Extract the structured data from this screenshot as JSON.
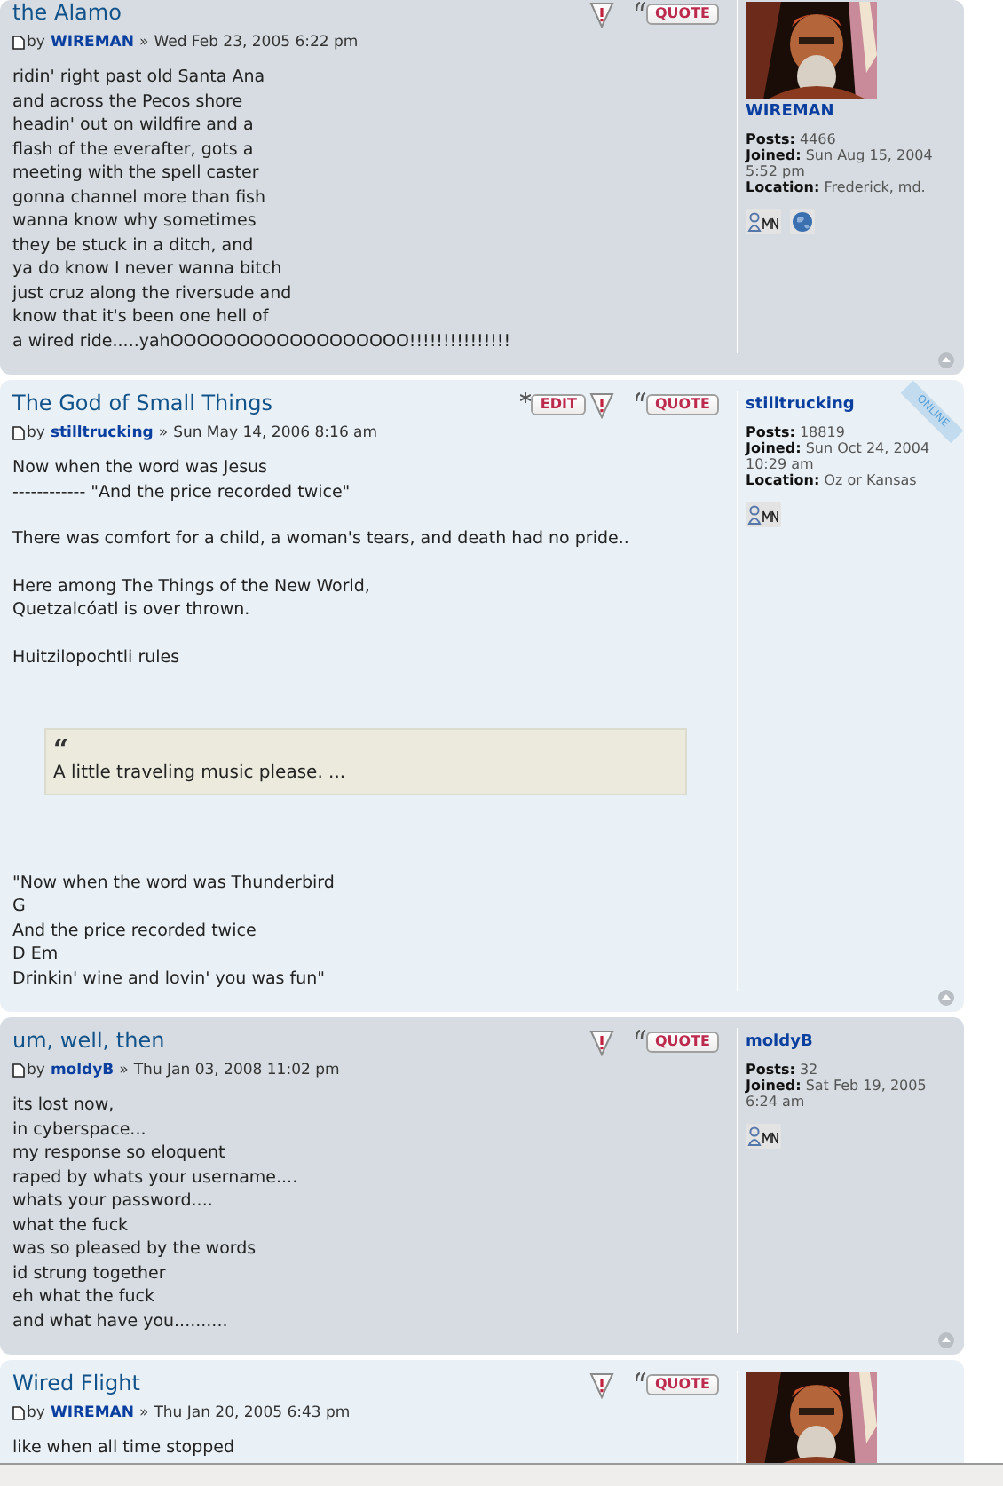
{
  "posts": [
    {
      "title": "the Alamo",
      "by": "by",
      "author": "WIREMAN",
      "sep": "»",
      "date": "Wed Feb 23, 2005 6:22 pm",
      "online": false,
      "buttons": [
        {
          "kind": "report"
        },
        {
          "kind": "quote",
          "label": "QUOTE"
        }
      ],
      "body": [
        {
          "kind": "verse",
          "lines": [
            "ridin' right past old Santa Ana",
            "and across the Pecos shore",
            "headin' out on wildfire and a",
            "flash of the everafter, gots a",
            "meeting with the spell caster",
            "gonna channel more than fish",
            "wanna know why sometimes",
            "they be stuck in a ditch, and",
            "ya do know I never wanna bitch",
            "just cruz along the riversude and",
            "know that it's been one hell of",
            "a wired ride.....yahOOOOOOOOOOOOOOOOOO!!!!!!!!!!!!!!!"
          ]
        }
      ],
      "profile": {
        "avatar": {
          "kind": "picture"
        },
        "name": "WIREMAN",
        "fields": [
          {
            "label": "Posts:",
            "value": "4466"
          },
          {
            "label": "Joined:",
            "value": "Sun Aug 15, 2004 5:52 pm"
          },
          {
            "label": "Location:",
            "value": "Frederick, md."
          }
        ],
        "contacts": [
          {
            "kind": "pm"
          },
          {
            "kind": "website"
          }
        ]
      }
    },
    {
      "title": "The God of Small Things",
      "by": "by",
      "author": "stilltrucking",
      "sep": "»",
      "date": "Sun May 14, 2006 8:16 am",
      "online": true,
      "online_label": "ONLINE",
      "buttons": [
        {
          "kind": "edit",
          "label": "EDIT"
        },
        {
          "kind": "report"
        },
        {
          "kind": "quote",
          "label": "QUOTE"
        }
      ],
      "body": [
        {
          "kind": "verse",
          "lines": [
            "Now when the word was Jesus",
            "------------ \"And the price recorded twice\""
          ]
        },
        {
          "kind": "verse",
          "lines": [
            "There was comfort for a child, a woman's tears, and death had no pride.."
          ]
        },
        {
          "kind": "verse",
          "lines": [
            "Here among The Things of the New World,",
            "Quetzalcóatl is over thrown."
          ]
        },
        {
          "kind": "verse",
          "lines": [
            "Huitzilopochtli rules"
          ]
        },
        {
          "kind": "quote",
          "mark": "“",
          "text": "A little traveling music please. ..."
        },
        {
          "kind": "verse",
          "lines": [
            "\"Now when the word was Thunderbird",
            "G",
            "And the price recorded twice",
            "D Em",
            "Drinkin' wine and lovin' you was fun\""
          ]
        }
      ],
      "profile": {
        "name": "stilltrucking",
        "fields": [
          {
            "label": "Posts:",
            "value": "18819"
          },
          {
            "label": "Joined:",
            "value": "Sun Oct 24, 2004 10:29 am"
          },
          {
            "label": "Location:",
            "value": "Oz or Kansas"
          }
        ],
        "contacts": [
          {
            "kind": "pm"
          }
        ]
      }
    },
    {
      "title": "um, well, then",
      "by": "by",
      "author": "moldyB",
      "sep": "»",
      "date": "Thu Jan 03, 2008 11:02 pm",
      "online": false,
      "buttons": [
        {
          "kind": "report"
        },
        {
          "kind": "quote",
          "label": "QUOTE"
        }
      ],
      "body": [
        {
          "kind": "verse",
          "lines": [
            "its lost now,",
            "in cyberspace...",
            "my response so eloquent",
            "raped by whats your username....",
            "whats your password....",
            "what the fuck",
            "was so pleased by the words",
            "id strung together",
            "eh what the fuck",
            "and what have you.........."
          ]
        }
      ],
      "profile": {
        "name": "moldyB",
        "fields": [
          {
            "label": "Posts:",
            "value": "32"
          },
          {
            "label": "Joined:",
            "value": "Sat Feb 19, 2005 6:24 am"
          }
        ],
        "contacts": [
          {
            "kind": "pm"
          }
        ]
      }
    },
    {
      "title": "Wired Flight",
      "by": "by",
      "author": "WIREMAN",
      "sep": "»",
      "date": "Thu Jan 20, 2005 6:43 pm",
      "online": false,
      "buttons": [
        {
          "kind": "report"
        },
        {
          "kind": "quote",
          "label": "QUOTE"
        }
      ],
      "body": [
        {
          "kind": "verse",
          "lines": [
            "like when all time stopped"
          ]
        }
      ],
      "profile": {
        "avatar": {
          "kind": "picture"
        }
      }
    }
  ]
}
